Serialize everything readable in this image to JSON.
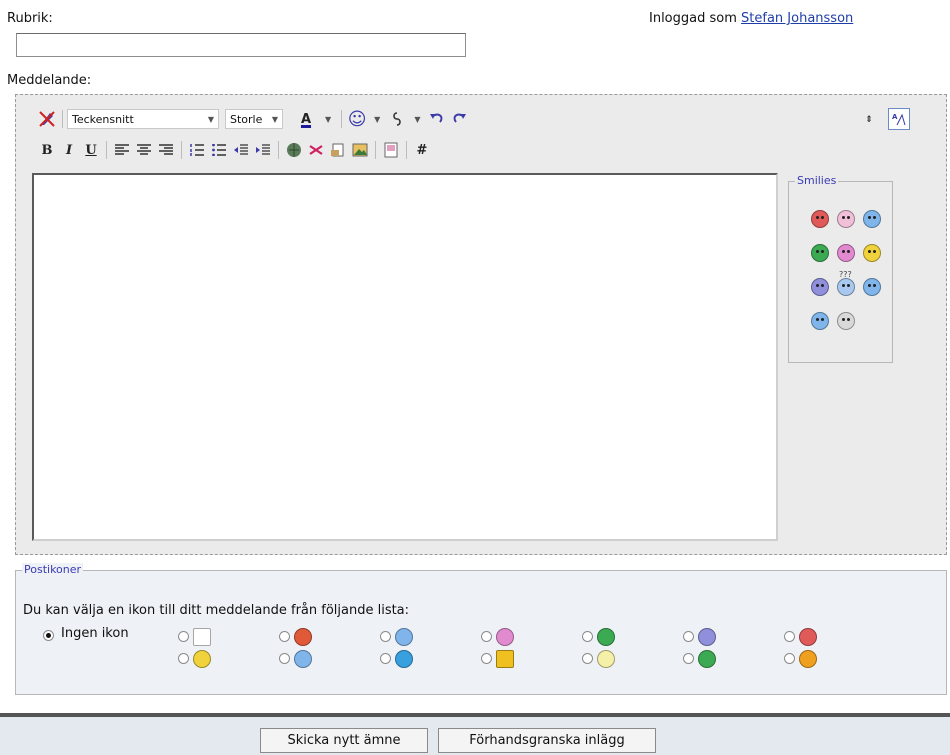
{
  "form": {
    "subject_label": "Rubrik:",
    "subject_value": "",
    "logged_in_label": "Inloggad som",
    "user_name": "Stefan Johansson",
    "message_label": "Meddelande:"
  },
  "toolbar": {
    "font_combo": "Teckensnitt",
    "size_combo": "Storle",
    "color_glyph": "A",
    "smiley_glyph": "☺",
    "bold": "B",
    "italic": "I",
    "underline": "U",
    "hash": "#"
  },
  "smilies": {
    "legend": "Smilies",
    "items": [
      {
        "name": "angry",
        "color": "#e05a5a"
      },
      {
        "name": "tongue",
        "color": "#f0c0d8"
      },
      {
        "name": "wink",
        "color": "#7fb5ea"
      },
      {
        "name": "grin",
        "color": "#3caa52"
      },
      {
        "name": "laugh",
        "color": "#e28ad0"
      },
      {
        "name": "smile",
        "color": "#f0d23c"
      },
      {
        "name": "sad",
        "color": "#8f8fdc"
      },
      {
        "name": "confused",
        "color": "#a8c8f0"
      },
      {
        "name": "wink2",
        "color": "#7fb5ea"
      },
      {
        "name": "cool",
        "color": "#7fb5ea"
      },
      {
        "name": "shocked",
        "color": "#d9d9d9"
      }
    ],
    "confused_marks": "???"
  },
  "post_icons": {
    "legend": "Postikoner",
    "instruction": "Du kan välja en ikon till ditt meddelande från följande lista:",
    "none_label": "Ingen ikon",
    "icons": [
      {
        "name": "document",
        "color": "#ffffff"
      },
      {
        "name": "thumbs-down",
        "color": "#e05a3a"
      },
      {
        "name": "wink",
        "color": "#7fb5ea"
      },
      {
        "name": "laugh",
        "color": "#e28ad0"
      },
      {
        "name": "grin",
        "color": "#3caa52"
      },
      {
        "name": "sad",
        "color": "#8f8fdc"
      },
      {
        "name": "angry",
        "color": "#e05a5a"
      },
      {
        "name": "smile",
        "color": "#f0d23c"
      },
      {
        "name": "cool",
        "color": "#7fb5ea"
      },
      {
        "name": "question",
        "color": "#39a0e0"
      },
      {
        "name": "warning",
        "color": "#f0c020"
      },
      {
        "name": "lightbulb",
        "color": "#f5f0a8"
      },
      {
        "name": "arrow",
        "color": "#3caa52"
      },
      {
        "name": "thumbs-up",
        "color": "#f0a020"
      }
    ]
  },
  "buttons": {
    "submit": "Skicka nytt ämne",
    "preview": "Förhandsgranska inlägg"
  }
}
